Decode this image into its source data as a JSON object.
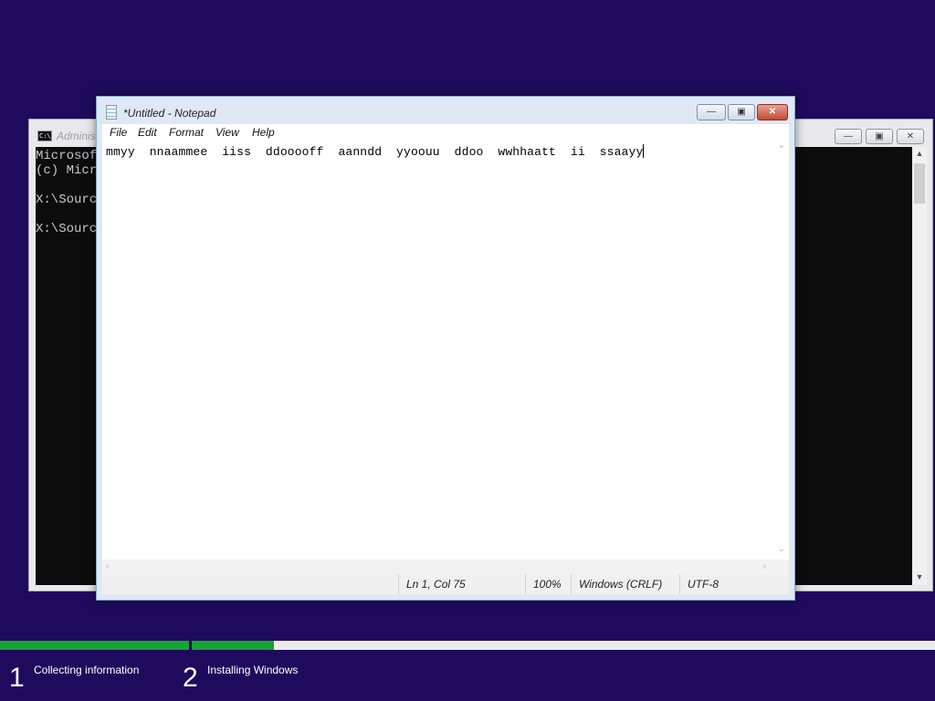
{
  "cmd_window": {
    "title": "Adminis",
    "icon_text": "C:\\.",
    "console_lines": [
      "Microsof",
      "(c) Micr",
      "",
      "X:\\Sourc",
      "",
      "X:\\Sourc"
    ]
  },
  "notepad": {
    "title": "*Untitled - Notepad",
    "menu": [
      "File",
      "Edit",
      "Format",
      "View",
      "Help"
    ],
    "text": "mmyy  nnaammee  iiss  ddooooff  aanndd  yyoouu  ddoo  wwhhaatt  ii  ssaayy",
    "status": {
      "position": "Ln 1, Col 75",
      "zoom": "100%",
      "line_ending": "Windows (CRLF)",
      "encoding": "UTF-8"
    }
  },
  "setup": {
    "step1_number": "1",
    "step1_label": "Collecting information",
    "step2_number": "2",
    "step2_label": "Installing Windows",
    "step1_progress": 1.0,
    "step2_progress": 0.11,
    "progress_color": "#16a431"
  },
  "colors": {
    "background": "#1e0b5e"
  }
}
